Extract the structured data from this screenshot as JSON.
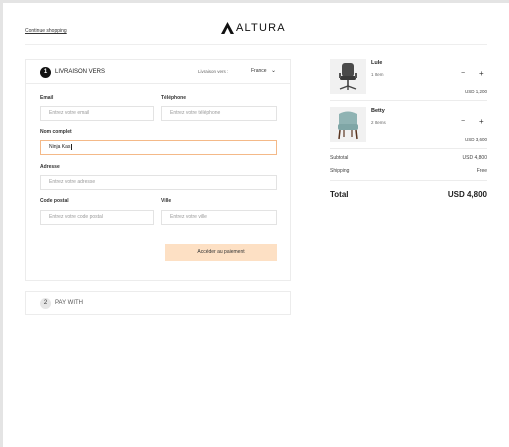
{
  "header": {
    "continue_link": "Continue shopping",
    "logo_text": "ALTURA"
  },
  "shipping": {
    "step_number": "1",
    "title": "LIVRAISON VERS",
    "ship_to_label": "Livraison vers :",
    "country": "France",
    "fields": {
      "email": {
        "label": "Email",
        "placeholder": "Entrez votre email",
        "value": ""
      },
      "phone": {
        "label": "Téléphone",
        "placeholder": "Entrez votre téléphone",
        "value": ""
      },
      "full_name": {
        "label": "Nom complet",
        "placeholder": "",
        "value": "Ninja Kas"
      },
      "address": {
        "label": "Adresse",
        "placeholder": "Entrez votre adresse",
        "value": ""
      },
      "postal_code": {
        "label": "Code postal",
        "placeholder": "Entrez votre code postal",
        "value": ""
      },
      "city": {
        "label": "Ville",
        "placeholder": "Entrez votre ville",
        "value": ""
      }
    },
    "submit_label": "Accéder au paiement"
  },
  "payment": {
    "step_number": "2",
    "title": "PAY WITH"
  },
  "cart": {
    "items": [
      {
        "name": "Lule",
        "qty": "1 Item",
        "price": "USD 1,200",
        "minus": "−",
        "plus": "+",
        "icon": "office-chair-image"
      },
      {
        "name": "Betty",
        "qty": "2 Items",
        "price": "USD 3,600",
        "minus": "−",
        "plus": "+",
        "icon": "armchair-image"
      }
    ],
    "subtotal_label": "Subtotal",
    "subtotal_value": "USD 4,800",
    "shipping_label": "Shipping",
    "shipping_value": "Free",
    "total_label": "Total",
    "total_value": "USD 4,800"
  },
  "colors": {
    "accent_button": "#fde0c4",
    "active_border": "#f4b988",
    "step_active": "#111111"
  }
}
